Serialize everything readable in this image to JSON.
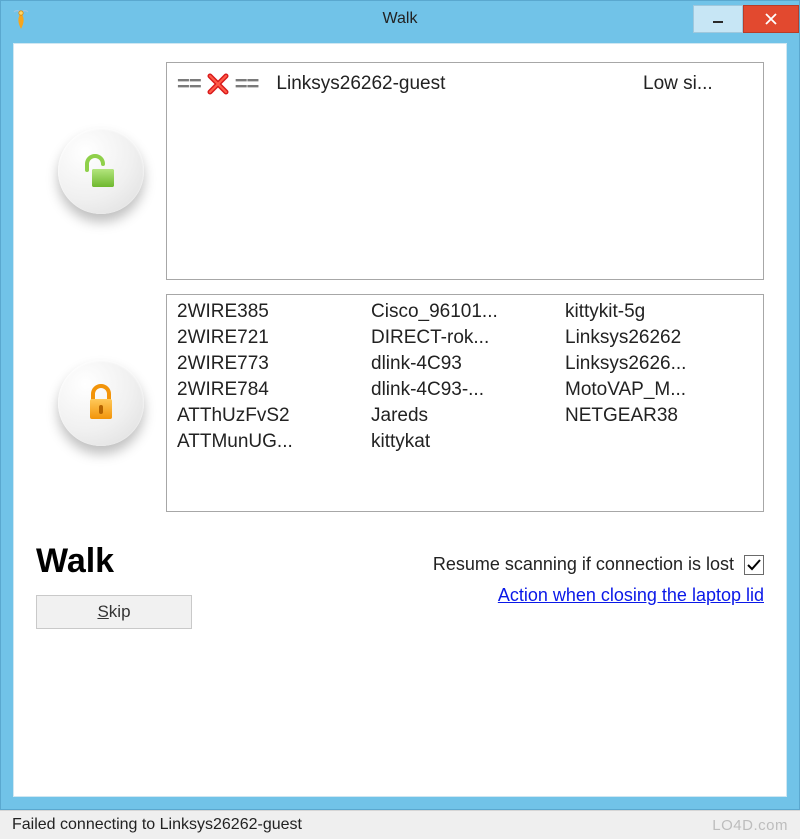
{
  "window": {
    "title": "Walk"
  },
  "open_networks": {
    "items": [
      {
        "ssid": "Linksys26262-guest",
        "signal": "Low si...",
        "failed": true
      }
    ]
  },
  "locked_networks": {
    "col1": [
      "2WIRE385",
      "2WIRE721",
      "2WIRE773",
      "2WIRE784",
      "ATThUzFvS2",
      "ATTMunUG..."
    ],
    "col2": [
      "Cisco_96101...",
      "DIRECT-rok...",
      "dlink-4C93",
      "dlink-4C93-...",
      "Jareds",
      "kittykat"
    ],
    "col3": [
      "kittykit-5g",
      "Linksys26262",
      "Linksys2626...",
      "MotoVAP_M...",
      "NETGEAR38",
      ""
    ]
  },
  "bottom": {
    "mode_title": "Walk",
    "skip_label_prefix": "S",
    "skip_label_rest": "kip",
    "resume_label": "Resume scanning if connection is lost",
    "resume_checked": true,
    "lid_link": "Action when closing the laptop lid"
  },
  "status": {
    "text": "Failed connecting to Linksys26262-guest",
    "watermark": "LO4D.com"
  }
}
